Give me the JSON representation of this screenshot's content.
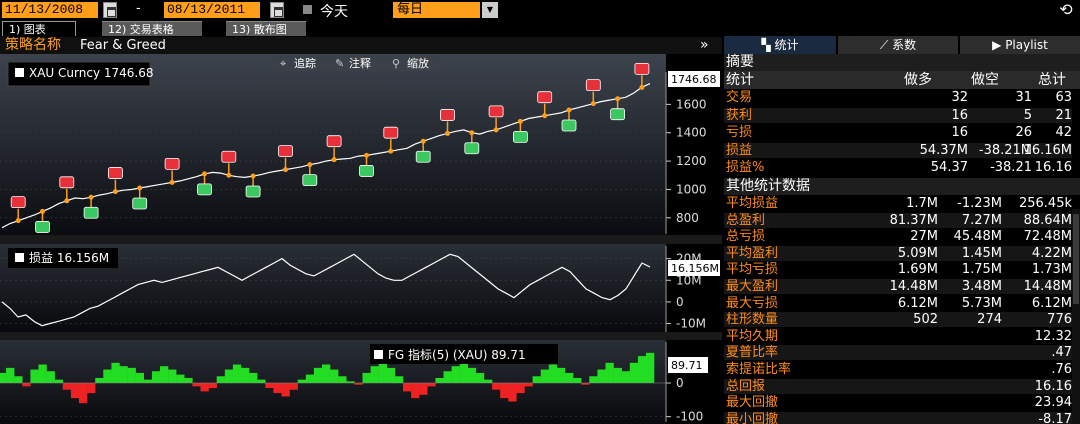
{
  "toolbar": {
    "start_date": "11/13/2008",
    "end_date": "08/13/2011",
    "dash": "-",
    "today_label": "今天",
    "period": "每日",
    "period_dropdown": "▼",
    "refresh_icon": "refresh-icon"
  },
  "tabs": [
    {
      "label": "1) 图表"
    },
    {
      "label": "12) 交易表格"
    },
    {
      "label": "13) 散布图"
    }
  ],
  "strategy": {
    "label": "策略名称",
    "value": "Fear & Greed",
    "expand": "»"
  },
  "chart_tools": {
    "track": "追踪",
    "annotate": "注释",
    "zoom": "缩放"
  },
  "chart_data": [
    {
      "type": "line",
      "legend": "XAU Curncy 1746.68",
      "last_value_label": "1746.68",
      "ylim": [
        700,
        1800
      ],
      "y_ticks": [
        "1600",
        "1400",
        "1200",
        "1000",
        "800"
      ],
      "series": [
        {
          "name": "XAU Curncy",
          "values": [
            730,
            760,
            780,
            800,
            820,
            845,
            870,
            900,
            920,
            940,
            935,
            945,
            960,
            970,
            985,
            995,
            1000,
            1010,
            1020,
            1030,
            1040,
            1050,
            1060,
            1075,
            1090,
            1110,
            1120,
            1115,
            1100,
            1090,
            1085,
            1095,
            1105,
            1120,
            1130,
            1140,
            1150,
            1160,
            1175,
            1185,
            1200,
            1210,
            1215,
            1220,
            1235,
            1240,
            1250,
            1260,
            1270,
            1280,
            1290,
            1320,
            1340,
            1360,
            1380,
            1395,
            1410,
            1420,
            1400,
            1390,
            1410,
            1420,
            1440,
            1460,
            1480,
            1500,
            1510,
            1520,
            1530,
            1540,
            1560,
            1575,
            1590,
            1605,
            1620,
            1630,
            1640,
            1650,
            1680,
            1720,
            1746.68
          ]
        }
      ]
    },
    {
      "type": "line",
      "legend": "损益 16.156M",
      "last_value_label": "16.156M",
      "ylim": [
        -13,
        24
      ],
      "y_ticks": [
        "20M",
        "10M",
        "0",
        "-10M"
      ],
      "series": [
        {
          "name": "损益",
          "values": [
            0,
            -3,
            -7,
            -6,
            -9,
            -11,
            -10,
            -9,
            -8,
            -7,
            -5,
            -3,
            -2,
            0,
            2,
            4,
            6,
            8,
            9,
            10,
            9,
            10,
            11,
            12,
            13,
            14,
            15,
            16,
            14,
            12,
            10,
            12,
            14,
            16,
            18,
            20,
            17,
            15,
            13,
            12,
            14,
            16,
            18,
            20,
            22,
            19,
            16,
            13,
            11,
            10,
            10,
            12,
            14,
            16,
            18,
            20,
            22,
            21,
            18,
            15,
            12,
            9,
            6,
            4,
            2,
            5,
            8,
            10,
            12,
            14,
            16,
            14,
            10,
            6,
            4,
            2,
            1,
            3,
            6,
            12,
            18,
            16.156
          ]
        }
      ]
    },
    {
      "type": "bar",
      "legend": "FG 指标(5) (XAU) 89.71",
      "last_value_label": "89.71",
      "ylim": [
        -110,
        110
      ],
      "y_ticks": [
        "0",
        "-100"
      ],
      "series": [
        {
          "name": "FG 指标(5) (XAU)",
          "values": [
            30,
            45,
            20,
            -10,
            40,
            55,
            35,
            10,
            -20,
            -45,
            -60,
            -30,
            15,
            40,
            60,
            50,
            45,
            30,
            10,
            35,
            50,
            40,
            25,
            15,
            -10,
            -25,
            -15,
            20,
            40,
            55,
            45,
            30,
            10,
            -15,
            -30,
            -40,
            -20,
            10,
            25,
            45,
            55,
            40,
            20,
            5,
            -5,
            30,
            50,
            65,
            45,
            20,
            -25,
            -45,
            -35,
            -10,
            15,
            35,
            50,
            60,
            45,
            30,
            10,
            -20,
            -45,
            -55,
            -30,
            -10,
            20,
            40,
            55,
            45,
            30,
            15,
            -5,
            20,
            40,
            60,
            45,
            35,
            60,
            80,
            89.71
          ]
        }
      ]
    }
  ],
  "right_panel": {
    "tabs": [
      {
        "icon": "stats-icon",
        "label": "统计"
      },
      {
        "icon": "trend-icon",
        "label": "系数"
      },
      {
        "icon": "play-icon",
        "label": "Playlist"
      }
    ],
    "summary_title": "摘要",
    "summary_cols": [
      "统计",
      "做多",
      "做空",
      "总计"
    ],
    "summary_rows": [
      {
        "label": "交易",
        "long": "32",
        "short": "31",
        "total": "63"
      },
      {
        "label": "获利",
        "long": "16",
        "short": "5",
        "total": "21"
      },
      {
        "label": "亏损",
        "long": "16",
        "short": "26",
        "total": "42"
      },
      {
        "label": "损益",
        "long": "54.37M",
        "short": "-38.21M",
        "total": "16.16M"
      },
      {
        "label": "损益%",
        "long": "54.37",
        "short": "-38.21",
        "total": "16.16"
      }
    ],
    "other_title": "其他统计数据",
    "other_rows": [
      {
        "label": "平均损益",
        "long": "1.7M",
        "short": "-1.23M",
        "total": "256.45k"
      },
      {
        "label": "总盈利",
        "long": "81.37M",
        "short": "7.27M",
        "total": "88.64M"
      },
      {
        "label": "总亏损",
        "long": "27M",
        "short": "45.48M",
        "total": "72.48M"
      },
      {
        "label": "平均盈利",
        "long": "5.09M",
        "short": "1.45M",
        "total": "4.22M"
      },
      {
        "label": "平均亏损",
        "long": "1.69M",
        "short": "1.75M",
        "total": "1.73M"
      },
      {
        "label": "最大盈利",
        "long": "14.48M",
        "short": "3.48M",
        "total": "14.48M"
      },
      {
        "label": "最大亏损",
        "long": "6.12M",
        "short": "5.73M",
        "total": "6.12M"
      },
      {
        "label": "柱形数量",
        "long": "502",
        "short": "274",
        "total": "776"
      },
      {
        "label": "平均久期",
        "long": "",
        "short": "",
        "total": "12.32"
      },
      {
        "label": "夏普比率",
        "long": "",
        "short": "",
        "total": ".47"
      },
      {
        "label": "索提诺比率",
        "long": "",
        "short": "",
        "total": ".76"
      },
      {
        "label": "总回报",
        "long": "",
        "short": "",
        "total": "16.16"
      },
      {
        "label": "最大回撤",
        "long": "",
        "short": "",
        "total": "23.94"
      },
      {
        "label": "最小回撤",
        "long": "",
        "short": "",
        "total": "-8.17"
      }
    ]
  },
  "colors": {
    "orange": "#ff9e1a",
    "green_bar": "#22dd22",
    "red_bar": "#ee2222",
    "sell_marker": "#e8303a",
    "buy_marker": "#3cc860"
  }
}
